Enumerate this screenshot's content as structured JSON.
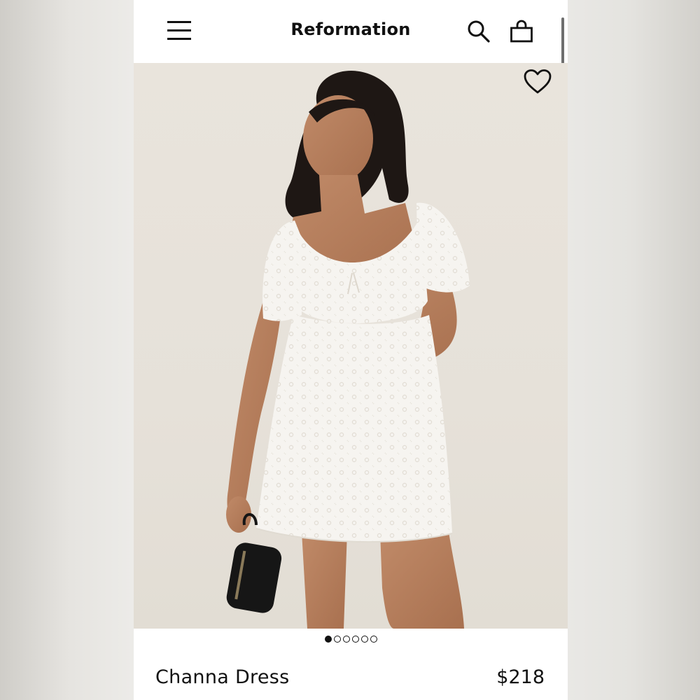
{
  "header": {
    "brand": "Reformation",
    "menu_icon": "hamburger-menu-icon",
    "search_icon": "search-icon",
    "bag_icon": "shopping-bag-icon"
  },
  "product": {
    "name": "Channa Dress",
    "price": "$218",
    "favorite_icon": "heart-outline-icon",
    "image_count": 6,
    "active_image_index": 0
  },
  "colors": {
    "text": "#111111",
    "photo_background": "#e7e2da"
  }
}
